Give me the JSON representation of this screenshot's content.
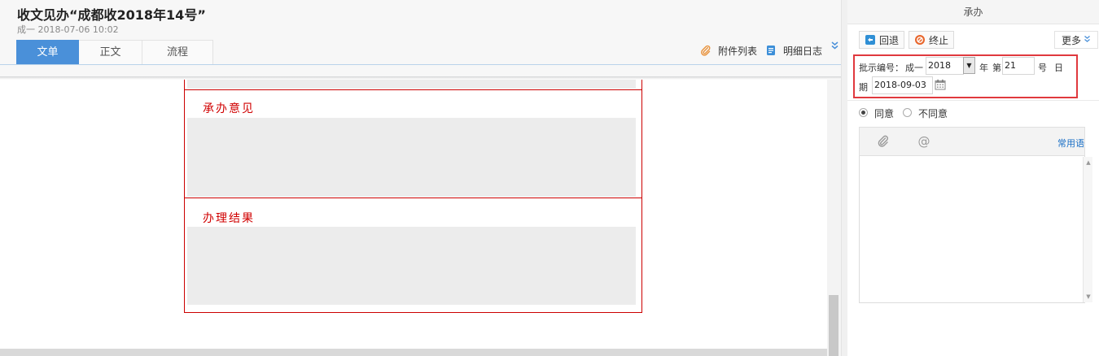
{
  "header": {
    "title": "收文见办“成都收2018年14号”",
    "meta": "成一 2018-07-06 10:02",
    "tabs": [
      {
        "label": "文单",
        "active": true
      },
      {
        "label": "正文",
        "active": false
      },
      {
        "label": "流程",
        "active": false
      }
    ],
    "actions": {
      "attachments": "附件列表",
      "detail_log": "明细日志"
    }
  },
  "form": {
    "sections": [
      {
        "label": "承办意见"
      },
      {
        "label": "办理结果"
      }
    ]
  },
  "panel": {
    "title": "承办",
    "buttons": {
      "return": "回退",
      "terminate": "终止",
      "more": "更多"
    },
    "approval": {
      "number_label": "批示编号：",
      "prefix": "成一",
      "year": "2018",
      "year_unit": "年",
      "ordinal_prefix": "第",
      "number": "21",
      "number_unit": "号",
      "date_label_1": "日",
      "date_label_2": "期",
      "date": "2018-09-03"
    },
    "decision": {
      "agree": "同意",
      "disagree": "不同意",
      "selected": "agree"
    },
    "editor": {
      "common_phrases": "常用语",
      "content": ""
    }
  },
  "colors": {
    "accent": "#4a90d9",
    "form_border": "#cc0000",
    "form_label": "#d00000",
    "highlight_box": "#e0393e",
    "link": "#1a6fc6"
  },
  "icons": [
    "paperclip-icon",
    "log-icon",
    "return-icon",
    "stop-icon",
    "calendar-icon",
    "at-icon",
    "chevron-double-down-icon"
  ]
}
